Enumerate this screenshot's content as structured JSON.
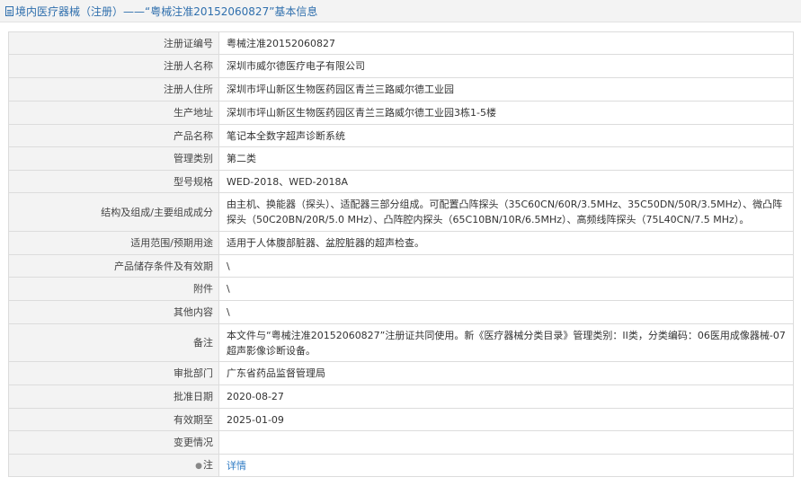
{
  "header": {
    "title": "境内医疗器械（注册）——“粤械注准20152060827”基本信息"
  },
  "rows": [
    {
      "label": "注册证编号",
      "value": "粤械注准20152060827"
    },
    {
      "label": "注册人名称",
      "value": "深圳市威尔德医疗电子有限公司"
    },
    {
      "label": "注册人住所",
      "value": "深圳市坪山新区生物医药园区青兰三路威尔德工业园"
    },
    {
      "label": "生产地址",
      "value": "深圳市坪山新区生物医药园区青兰三路威尔德工业园3栋1-5楼"
    },
    {
      "label": "产品名称",
      "value": "笔记本全数字超声诊断系统"
    },
    {
      "label": "管理类别",
      "value": "第二类"
    },
    {
      "label": "型号规格",
      "value": "WED-2018、WED-2018A"
    },
    {
      "label": "结构及组成/主要组成成分",
      "value": "由主机、换能器（探头）、适配器三部分组成。可配置凸阵探头（35C60CN/60R/3.5MHz、35C50DN/50R/3.5MHz）、微凸阵探头（50C20BN/20R/5.0 MHz）、凸阵腔内探头（65C10BN/10R/6.5MHz）、高频线阵探头（75L40CN/7.5 MHz）。"
    },
    {
      "label": "适用范围/预期用途",
      "value": "适用于人体腹部脏器、盆腔脏器的超声检查。"
    },
    {
      "label": "产品储存条件及有效期",
      "value": "\\"
    },
    {
      "label": "附件",
      "value": "\\"
    },
    {
      "label": "其他内容",
      "value": "\\"
    },
    {
      "label": "备注",
      "value": "本文件与“粤械注准20152060827”注册证共同使用。新《医疗器械分类目录》管理类别：II类，分类编码：06医用成像器械-07超声影像诊断设备。"
    },
    {
      "label": "审批部门",
      "value": "广东省药品监督管理局"
    },
    {
      "label": "批准日期",
      "value": "2020-08-27"
    },
    {
      "label": "有效期至",
      "value": "2025-01-09"
    },
    {
      "label": "变更情况",
      "value": ""
    },
    {
      "label": "注",
      "value": "详情"
    }
  ]
}
